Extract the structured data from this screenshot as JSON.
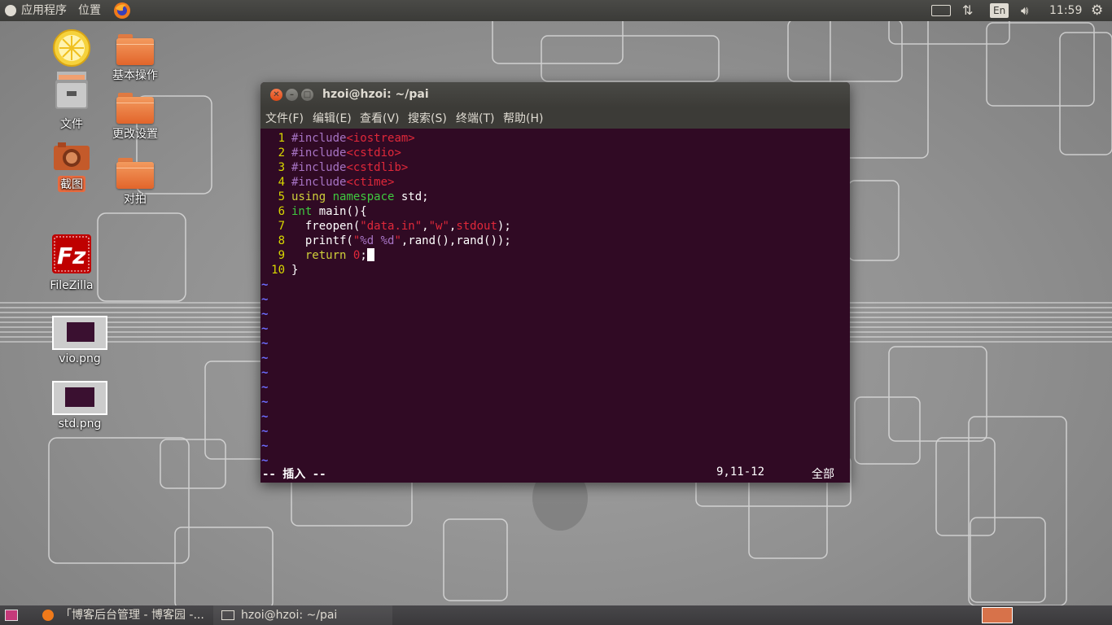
{
  "top_panel": {
    "applications": "应用程序",
    "places": "位置",
    "keyboard_lang": "En",
    "time": "11:59",
    "icons": [
      "ubuntu-logo-icon",
      "firefox-icon",
      "keyboard-icon",
      "network-icon",
      "volume-icon",
      "settings-gear-icon"
    ]
  },
  "desktop_icons": [
    {
      "label": "",
      "icon": "lemon-icon"
    },
    {
      "label": "文件",
      "icon": "file-manager-icon"
    },
    {
      "label": "截图",
      "icon": "camera-icon"
    },
    {
      "label": "基本操作",
      "icon": "folder-icon"
    },
    {
      "label": "更改设置",
      "icon": "folder-icon"
    },
    {
      "label": "对拍",
      "icon": "folder-icon"
    },
    {
      "label": "FileZilla",
      "icon": "filezilla-icon"
    },
    {
      "label": "vio.png",
      "icon": "image-thumbnail-icon"
    },
    {
      "label": "std.png",
      "icon": "image-thumbnail-icon"
    }
  ],
  "terminal": {
    "title": "hzoi@hzoi: ~/pai",
    "menu": [
      "文件(F)",
      "编辑(E)",
      "查看(V)",
      "搜索(S)",
      "终端(T)",
      "帮助(H)"
    ],
    "code": [
      {
        "n": "1",
        "tokens": [
          {
            "c": "t-pre",
            "t": "#include"
          },
          {
            "c": "t-str",
            "t": "<iostream>"
          }
        ]
      },
      {
        "n": "2",
        "tokens": [
          {
            "c": "t-pre",
            "t": "#include"
          },
          {
            "c": "t-str",
            "t": "<cstdio>"
          }
        ]
      },
      {
        "n": "3",
        "tokens": [
          {
            "c": "t-pre",
            "t": "#include"
          },
          {
            "c": "t-str",
            "t": "<cstdlib>"
          }
        ]
      },
      {
        "n": "4",
        "tokens": [
          {
            "c": "t-pre",
            "t": "#include"
          },
          {
            "c": "t-str",
            "t": "<ctime>"
          }
        ]
      },
      {
        "n": "5",
        "tokens": [
          {
            "c": "t-kw",
            "t": "using"
          },
          {
            "c": "t-fn",
            "t": " "
          },
          {
            "c": "t-type",
            "t": "namespace"
          },
          {
            "c": "t-fn",
            "t": " std;"
          }
        ]
      },
      {
        "n": "6",
        "tokens": [
          {
            "c": "t-type",
            "t": "int"
          },
          {
            "c": "t-fn",
            "t": " main(){"
          }
        ]
      },
      {
        "n": "7",
        "tokens": [
          {
            "c": "t-fn",
            "t": "  freopen("
          },
          {
            "c": "t-str",
            "t": "\"data.in\""
          },
          {
            "c": "t-fn",
            "t": ","
          },
          {
            "c": "t-str",
            "t": "\"w\""
          },
          {
            "c": "t-fn",
            "t": ","
          },
          {
            "c": "t-str",
            "t": "stdout"
          },
          {
            "c": "t-fn",
            "t": ");"
          }
        ]
      },
      {
        "n": "8",
        "tokens": [
          {
            "c": "t-fn",
            "t": "  printf("
          },
          {
            "c": "t-str",
            "t": "\""
          },
          {
            "c": "t-pre",
            "t": "%d %d"
          },
          {
            "c": "t-str",
            "t": "\""
          },
          {
            "c": "t-fn",
            "t": ",rand(),rand());"
          }
        ]
      },
      {
        "n": "9",
        "tokens": [
          {
            "c": "t-fn",
            "t": "  "
          },
          {
            "c": "t-kw",
            "t": "return"
          },
          {
            "c": "t-fn",
            "t": " "
          },
          {
            "c": "t-str",
            "t": "0"
          },
          {
            "c": "t-fn",
            "t": ";"
          }
        ]
      },
      {
        "n": "10",
        "tokens": [
          {
            "c": "t-fn",
            "t": "}"
          }
        ]
      }
    ],
    "tilde_count": 13,
    "mode": "-- 插入 --",
    "position": "9,11-12",
    "scroll": "全部"
  },
  "bottom_panel": {
    "tasks": [
      {
        "label": "「博客后台管理 - 博客园 -...",
        "icon": "firefox-icon"
      },
      {
        "label": "hzoi@hzoi: ~/pai",
        "icon": "terminal-icon"
      }
    ]
  },
  "colors": {
    "terminal_bg": "#300a24",
    "panel_bg": "#3c3b37",
    "line_number": "#d8d800",
    "preprocessor": "#a774c4",
    "string": "#e0283a",
    "type": "#3fc93f",
    "tilde": "#6c6cff"
  }
}
